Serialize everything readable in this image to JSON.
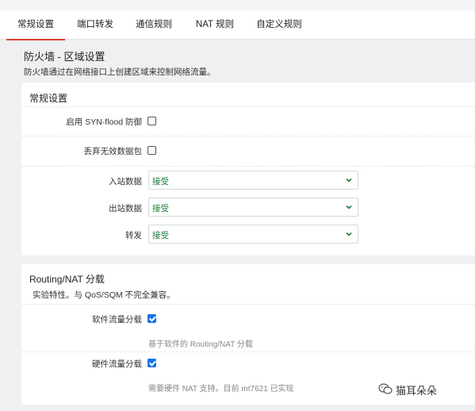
{
  "tabs": [
    {
      "label": "常规设置",
      "active": true
    },
    {
      "label": "端口转发",
      "active": false
    },
    {
      "label": "通信规则",
      "active": false
    },
    {
      "label": "NAT 规则",
      "active": false
    },
    {
      "label": "自定义规则",
      "active": false
    }
  ],
  "page": {
    "title": "防火墙 - 区域设置",
    "description": "防火墙通过在网络接口上创建区域来控制网络流量。"
  },
  "general": {
    "title": "常规设置",
    "synflood_label": "启用 SYN-flood 防御",
    "synflood_checked": false,
    "drop_invalid_label": "丢弃无效数据包",
    "drop_invalid_checked": false,
    "input_label": "入站数据",
    "input_value": "接受",
    "output_label": "出站数据",
    "output_value": "接受",
    "forward_label": "转发",
    "forward_value": "接受"
  },
  "offload": {
    "title": "Routing/NAT 分载",
    "description": "实验特性。与 QoS/SQM 不完全兼容。",
    "software_label": "软件流量分载",
    "software_checked": true,
    "software_note": "基于软件的 Routing/NAT 分载",
    "hardware_label": "硬件流量分载",
    "hardware_checked": true,
    "hardware_note": "需要硬件 NAT 支持。目前 mt7621 已实现"
  },
  "watermark": {
    "text": "猫耳朵朵",
    "icon": "wechat-icon"
  },
  "colors": {
    "tab_underline": "#d9402b",
    "select_text": "#1b7a3a",
    "checkbox_checked": "#1a73e8"
  }
}
